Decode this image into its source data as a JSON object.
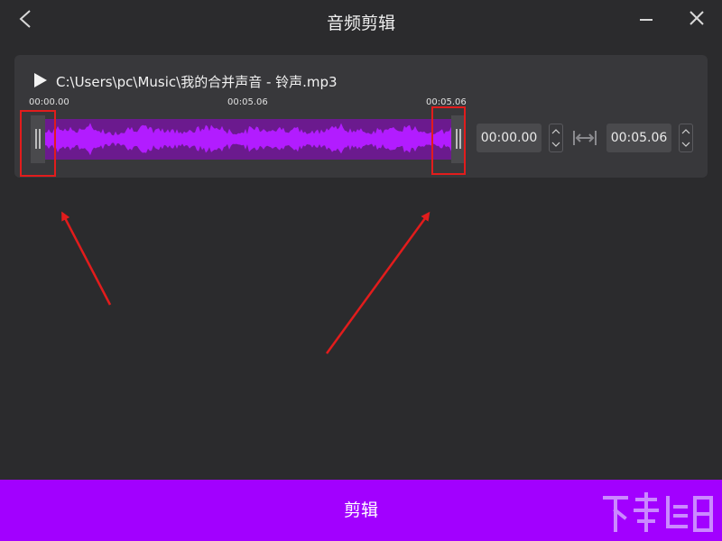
{
  "window": {
    "title": "音频剪辑"
  },
  "icons": {
    "back": "chevron-left-icon",
    "minimize": "minimize-icon",
    "close": "close-icon",
    "play": "play-icon",
    "length": "duration-icon"
  },
  "file": {
    "path": "C:\\Users\\pc\\Music\\我的合并声音 - 铃声.mp3"
  },
  "timeline": {
    "ticks": [
      "00:00.00",
      "00:05.06",
      "00:05.06"
    ]
  },
  "selection": {
    "start": "00:00.00",
    "end": "00:05.06"
  },
  "footer": {
    "cut_label": "剪辑"
  },
  "colors": {
    "accent": "#a200ff",
    "waveform": "#b21cff",
    "waveform_bg": "#6b1a8e",
    "annotation": "#e21c1c",
    "background": "#2b2b2d"
  }
}
